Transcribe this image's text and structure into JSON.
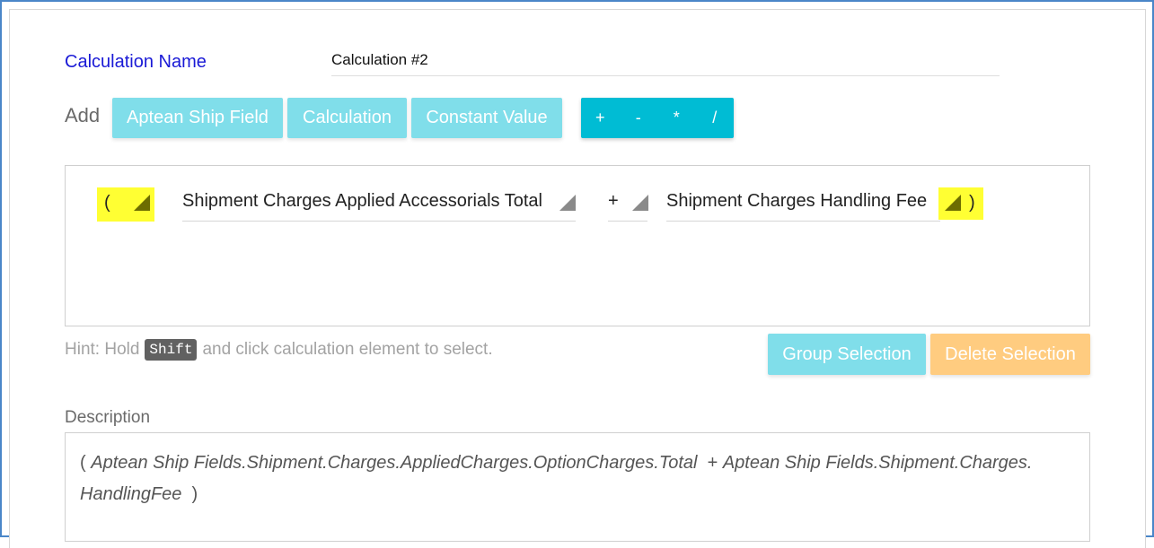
{
  "calculation_name": {
    "label": "Calculation Name",
    "value": "Calculation #2"
  },
  "add": {
    "label": "Add",
    "buttons": [
      "Aptean Ship Field",
      "Calculation",
      "Constant Value"
    ],
    "operators": [
      "+",
      "-",
      "*",
      "/"
    ]
  },
  "calculation": {
    "open_paren": "(",
    "field1": "Shipment Charges Applied Accessorials Total",
    "operator": "+",
    "field2": "Shipment Charges Handling Fee",
    "close_paren": ")"
  },
  "hint": {
    "prefix": "Hint: Hold",
    "key": "Shift",
    "suffix": "and click calculation element to select."
  },
  "selection_buttons": {
    "group": "Group Selection",
    "delete": "Delete Selection"
  },
  "description": {
    "label": "Description",
    "open_paren": "(",
    "term1": "Aptean Ship Fields.Shipment.Charges.AppliedCharges.OptionCharges.Total",
    "operator": "+",
    "term2": "Aptean Ship Fields.Shipment.Charges.",
    "term2_cont": "HandlingFee",
    "close_paren": ")"
  },
  "colors": {
    "frame_border": "#4a86c8",
    "label_blue": "#1a1ad6",
    "button_light": "#80deea",
    "button_operator": "#00bcd4",
    "button_delete": "#ffcc80",
    "highlight": "#ffff33"
  }
}
